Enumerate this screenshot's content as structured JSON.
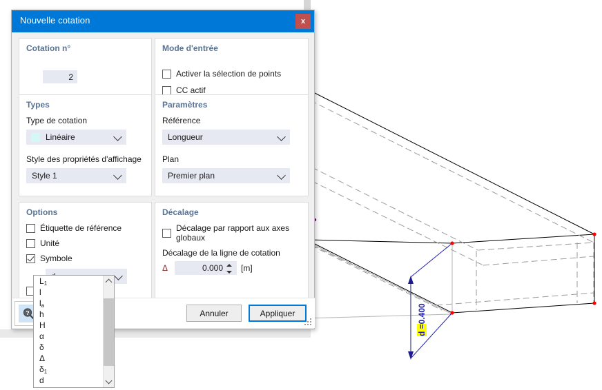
{
  "dialog": {
    "title": "Nouvelle cotation",
    "close_label": "x",
    "groups": {
      "cotation_no": {
        "title": "Cotation n°",
        "value": "2"
      },
      "mode_entree": {
        "title": "Mode d'entrée",
        "checkboxes": [
          {
            "label": "Activer la sélection de points",
            "checked": false
          },
          {
            "label": "CC actif",
            "checked": false
          }
        ]
      },
      "types": {
        "title": "Types",
        "type_cotation_label": "Type de cotation",
        "type_cotation_value": "Linéaire",
        "type_cotation_swatch": "#d4f7f7",
        "style_label": "Style des propriétés d'affichage",
        "style_value": "Style 1"
      },
      "parametres": {
        "title": "Paramètres",
        "reference_label": "Référence",
        "reference_value": "Longueur",
        "plan_label": "Plan",
        "plan_value": "Premier plan"
      },
      "options": {
        "title": "Options",
        "checkboxes": [
          {
            "label": "Étiquette de référence",
            "checked": false
          },
          {
            "label": "Unité",
            "checked": false
          },
          {
            "label": "Symbole",
            "checked": true
          }
        ],
        "symbol_combo_value": "d",
        "hidden_checkbox_checked": false
      },
      "decalage": {
        "title": "Décalage",
        "checkbox_label": "Décalage par rapport aux axes globaux",
        "checkbox_checked": false,
        "field_label": "Décalage de la ligne de cotation",
        "delta_symbol": "Δ",
        "delta_value": "0.000",
        "unit": "[m]"
      }
    },
    "footer": {
      "cancel_label": "Annuler",
      "apply_label": "Appliquer",
      "help_icon": "help-magnifier-icon"
    }
  },
  "symbol_dropdown": {
    "items": [
      {
        "main": "L",
        "sub": "1"
      },
      {
        "main": "l",
        "sub": ""
      },
      {
        "main": "l",
        "sub": "a"
      },
      {
        "main": "h",
        "sub": ""
      },
      {
        "main": "H",
        "sub": ""
      },
      {
        "main": "α",
        "sub": ""
      },
      {
        "main": "δ",
        "sub": ""
      },
      {
        "main": "Δ",
        "sub": ""
      },
      {
        "main": "δ",
        "sub": "1"
      },
      {
        "main": "d",
        "sub": ""
      }
    ]
  },
  "viewport": {
    "dimension_label_symbol": "d =",
    "dimension_label_value": "0.400",
    "node_color": "#ff0000",
    "dimension_color": "#2020b0",
    "marker_color": "#800080"
  }
}
